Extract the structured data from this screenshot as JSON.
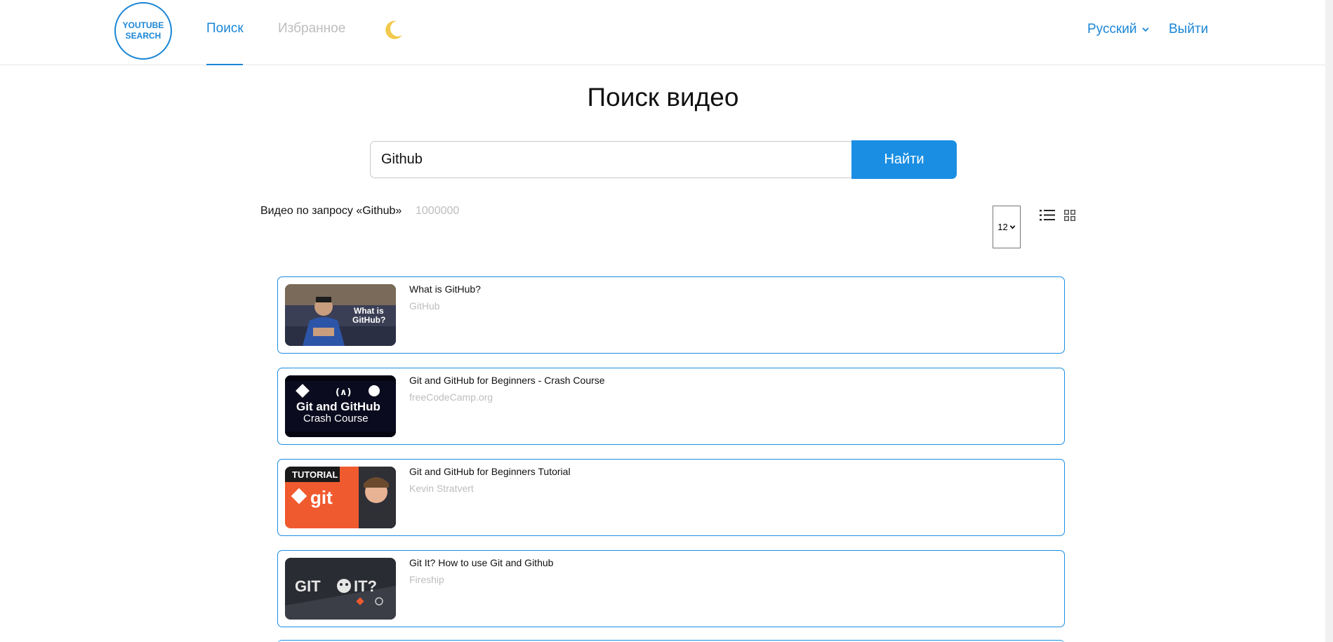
{
  "header": {
    "logo_line1": "YOUTUBE",
    "logo_line2": "SEARCH",
    "nav": {
      "search_label": "Поиск",
      "favorites_label": "Избранное"
    },
    "theme_icon": "moon-icon",
    "language_label": "Русский",
    "logout_label": "Выйти"
  },
  "main": {
    "title": "Поиск видео",
    "search": {
      "value": "Github",
      "button_label": "Найти"
    },
    "results": {
      "label": "Видео по запросу «Github»",
      "count": "1000000",
      "per_page": "12",
      "view_modes": [
        "list-view-icon",
        "grid-view-icon"
      ]
    },
    "videos": [
      {
        "title": "What is GitHub?",
        "channel": "GitHub",
        "thumb_text": "What is GitHub?"
      },
      {
        "title": "Git and GitHub for Beginners - Crash Course",
        "channel": "freeCodeCamp.org",
        "thumb_text1": "Git and GitHub",
        "thumb_text2": "Crash Course",
        "thumb_text_sym": "(∧)"
      },
      {
        "title": "Git and GitHub for Beginners Tutorial",
        "channel": "Kevin Stratvert",
        "thumb_text1": "TUTORIAL",
        "thumb_text2": "git"
      },
      {
        "title": "Git It? How to use Git and Github",
        "channel": "Fireship",
        "thumb_text1": "GIT",
        "thumb_text2": "IT?"
      }
    ]
  },
  "colors": {
    "accent": "#1a8ee3",
    "muted": "#bdbdbd",
    "moon": "#f2c94c"
  }
}
